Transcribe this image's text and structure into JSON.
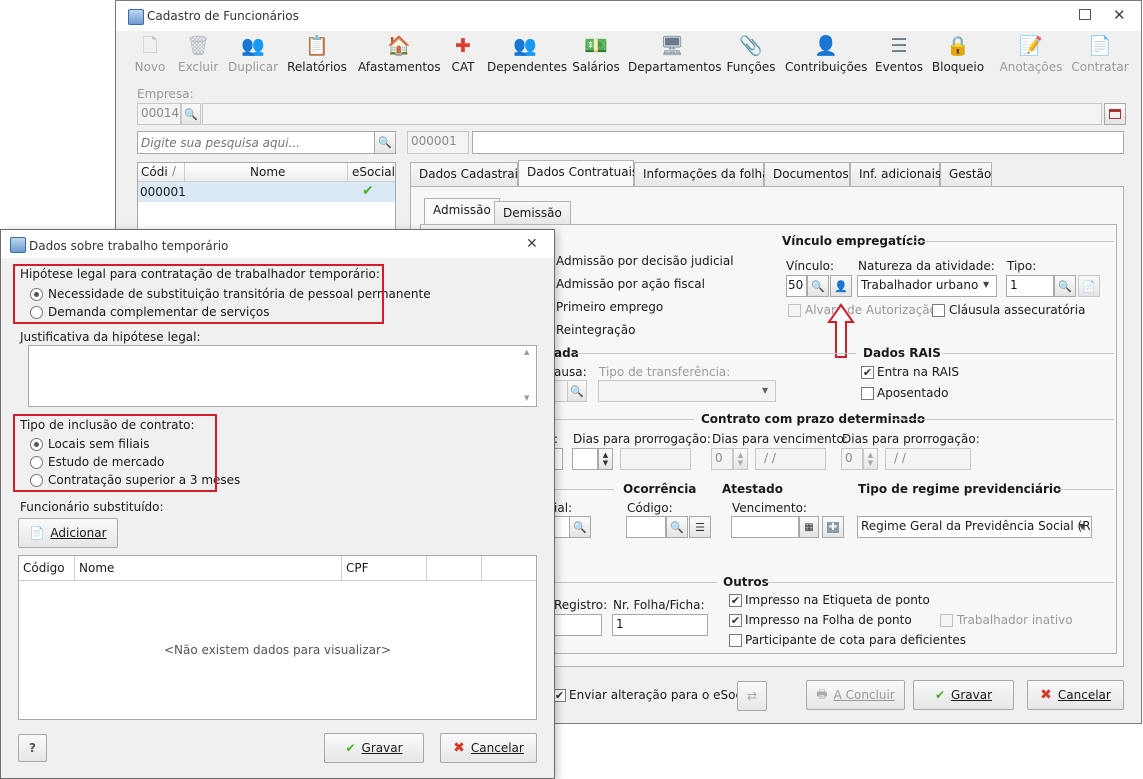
{
  "main_window": {
    "title": "Cadastro de Funcionários",
    "toolbar": [
      {
        "label": "Novo",
        "icon": "new-document-icon",
        "glyph": "🗋",
        "enabled": false
      },
      {
        "label": "Excluir",
        "icon": "trash-icon",
        "glyph": "🗑",
        "enabled": false
      },
      {
        "label": "Duplicar",
        "icon": "duplicate-users-icon",
        "glyph": "👥",
        "enabled": false
      },
      {
        "label": "Relatórios",
        "icon": "report-icon",
        "glyph": "📋",
        "enabled": true
      },
      {
        "label": "Afastamentos",
        "icon": "house-icon",
        "glyph": "🏠",
        "enabled": true
      },
      {
        "label": "CAT",
        "icon": "medical-cross-icon",
        "glyph": "✚",
        "enabled": true
      },
      {
        "label": "Dependentes",
        "icon": "people-icon",
        "glyph": "👥",
        "enabled": true
      },
      {
        "label": "Salários",
        "icon": "money-icon",
        "glyph": "💵",
        "enabled": true
      },
      {
        "label": "Departamentos",
        "icon": "desk-icon",
        "glyph": "🖥",
        "enabled": true
      },
      {
        "label": "Funções",
        "icon": "clipboard-icon",
        "glyph": "📎",
        "enabled": true
      },
      {
        "label": "Contribuições",
        "icon": "user-group-icon",
        "glyph": "👤",
        "enabled": true
      },
      {
        "label": "Eventos",
        "icon": "list-icon",
        "glyph": "☰",
        "enabled": true
      },
      {
        "label": "Bloqueio",
        "icon": "lock-icon",
        "glyph": "🔒",
        "enabled": true
      },
      {
        "label": "Anotações",
        "icon": "notes-icon",
        "glyph": "📝",
        "enabled": false
      },
      {
        "label": "Contratar",
        "icon": "hire-icon",
        "glyph": "📄",
        "enabled": false
      }
    ],
    "empresa_label": "Empresa:",
    "empresa_code": "00014",
    "search_placeholder": "Digite sua pesquisa aqui...",
    "employee_code_field": "000001",
    "list": {
      "columns": [
        "Códi",
        "Nome",
        "eSocial"
      ],
      "rows": [
        {
          "code": "000001",
          "name": "",
          "esocial": "✔"
        }
      ]
    },
    "tabs": [
      "Dados Cadastrais",
      "Dados Contratuais",
      "Informações da folha",
      "Documentos",
      "Inf. adicionais",
      "Gestão"
    ],
    "subtabs": [
      "Admissão",
      "Demissão"
    ],
    "admission_options": [
      "Admissão por decisão judicial",
      "Admissão por ação fiscal",
      "Primeiro emprego",
      "Reintegração"
    ],
    "vinculo": {
      "section": "Vínculo empregatício",
      "vinculo_label": "Vínculo:",
      "vinculo_value": "50",
      "natureza_label": "Natureza da atividade:",
      "natureza_value": "Trabalhador urbano",
      "tipo_label": "Tipo:",
      "tipo_value": "1",
      "alvara": "Alvará de Autorização",
      "clausula": "Cláusula assecuratória"
    },
    "transfer": {
      "section_partial": "ada",
      "causa_partial": "ausa:",
      "tipo_transferencia": "Tipo de transferência:"
    },
    "rais": {
      "section": "Dados RAIS",
      "entra": "Entra na RAIS",
      "aposentado": "Aposentado"
    },
    "contrato": {
      "section": "Contrato com prazo determinado",
      "dias_prorrogacao_1": "Dias para prorrogação:",
      "dias_vencimento": "Dias para vencimento:",
      "dias_prorrogacao_2": "Dias para prorrogação:",
      "zero_1": "0",
      "zero_2": "0",
      "date_1": "/ /",
      "date_2": "/ /"
    },
    "ocorrencia": {
      "section": "Ocorrência",
      "codigo_label": "Código:",
      "partial_label": "ial:"
    },
    "atestado": {
      "section": "Atestado",
      "vencimento_label": "Vencimento:"
    },
    "regime": {
      "section": "Tipo de regime previdenciário",
      "value": "Regime Geral da Previdência Social (RGP"
    },
    "outros": {
      "section": "Outros",
      "registro_partial": "Registro:",
      "folha_label": "Nr. Folha/Ficha:",
      "folha_value": "1",
      "etiqueta": "Impresso na Etiqueta de ponto",
      "folha_ponto": "Impresso na Folha de ponto",
      "inativo": "Trabalhador inativo",
      "cota": "Participante de cota para deficientes"
    },
    "footer": {
      "enviar": "Enviar alteração para o eSocial",
      "concluir": "A Concluir",
      "gravar": "Gravar",
      "cancelar": "Cancelar"
    }
  },
  "dialog": {
    "title": "Dados sobre trabalho temporário",
    "hipotese_label": "Hipótese legal para contratação de trabalhador temporário:",
    "hipotese_options": [
      "Necessidade de substituição transitória de pessoal permanente",
      "Demanda complementar de serviços"
    ],
    "justificativa_label": "Justificativa da hipótese legal:",
    "tipo_label": "Tipo de inclusão de contrato:",
    "tipo_options": [
      "Locais sem filiais",
      "Estudo de mercado",
      "Contratação superior a 3 meses"
    ],
    "funcionario_label": "Funcionário substituído:",
    "adicionar": "Adicionar",
    "grid_columns": [
      "Código",
      "Nome",
      "CPF"
    ],
    "empty_text": "<Não existem dados para visualizar>",
    "help": "?",
    "gravar": "Gravar",
    "cancelar": "Cancelar"
  },
  "colors": {
    "highlight_red": "#d11f2a",
    "ok_green": "#4caf2a",
    "cancel_red": "#d33a2c",
    "selected_row": "#dbe8f6"
  }
}
